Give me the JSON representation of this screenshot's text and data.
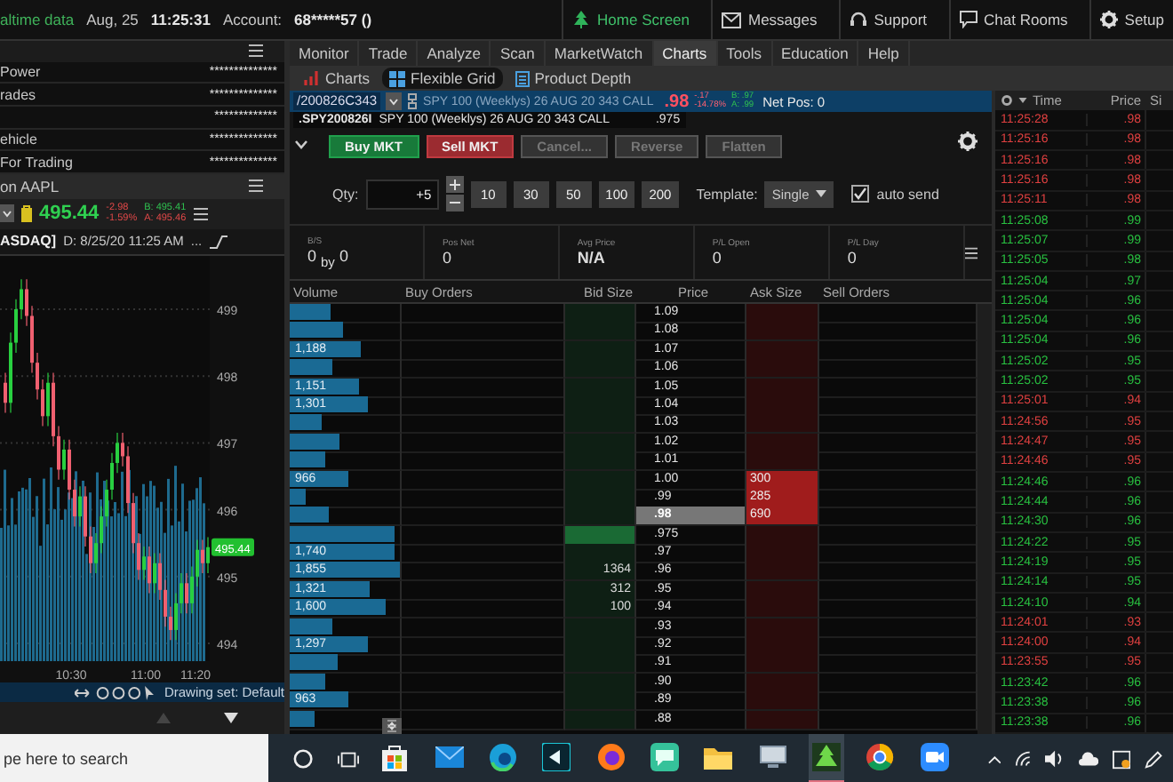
{
  "top_bar": {
    "data_feed": "altime data",
    "date": "Aug, 25",
    "time": "11:25:31",
    "account_label": "Account:",
    "account": "68*****57 ()",
    "links": [
      {
        "kind": "home",
        "label": "Home Screen",
        "selected": true
      },
      {
        "kind": "messages",
        "label": "Messages",
        "selected": false
      },
      {
        "kind": "support",
        "label": "Support",
        "selected": false
      },
      {
        "kind": "chat",
        "label": "Chat Rooms",
        "selected": false
      },
      {
        "kind": "setup",
        "label": "Setup",
        "selected": false
      }
    ]
  },
  "account_panel": {
    "rows": [
      {
        "label": "Power",
        "value": "**************"
      },
      {
        "label": "rades",
        "value": "**************"
      },
      {
        "value": "*************"
      },
      {
        "label": "ehicle",
        "value": "**************"
      },
      {
        "label": "For Trading",
        "value": "**************"
      }
    ]
  },
  "quote_panel": {
    "title": "on AAPL",
    "last": "495.44",
    "change": "-2.98",
    "change_pct": "-1.59%",
    "bid": "B: 495.41",
    "ask": "A: 495.46"
  },
  "chart": {
    "exchange": "ASDAQ]",
    "timestamp": "D: 8/25/20 11:25 AM",
    "more": "...",
    "price_ticks": [
      "499",
      "498",
      "497",
      "496",
      "495",
      "494"
    ],
    "time_ticks": [
      "10:30",
      "11:00",
      "11:20"
    ],
    "last_tag": "495.44",
    "drawing_set": "Drawing set: Default"
  },
  "main_tabs": [
    {
      "label": "Monitor",
      "selected": false
    },
    {
      "label": "Trade",
      "selected": false
    },
    {
      "label": "Analyze",
      "selected": false
    },
    {
      "label": "Scan",
      "selected": false
    },
    {
      "label": "MarketWatch",
      "selected": false
    },
    {
      "label": "Charts",
      "selected": true
    },
    {
      "label": "Tools",
      "selected": false
    },
    {
      "label": "Education",
      "selected": false
    },
    {
      "label": "Help",
      "selected": false
    }
  ],
  "sub_tabs": [
    {
      "kind": "charts",
      "label": "Charts",
      "selected": false
    },
    {
      "kind": "grid",
      "label": "Flexible Grid",
      "selected": true
    },
    {
      "kind": "depth",
      "label": "Product Depth",
      "selected": false
    }
  ],
  "symbol_bar": {
    "symbol": "/200826C343",
    "description": "SPY 100 (Weeklys) 26 AUG 20 343 CALL",
    "last": ".98",
    "change": "-.17",
    "change_pct": "-14.78%",
    "bid": "B: .97",
    "ask": "A: .99",
    "net_pos": "Net Pos: 0",
    "suggestion": {
      "symbol": ".SPY200826I",
      "description": "SPY 100 (Weeklys) 26 AUG 20 343 CALL",
      "price": ".975"
    }
  },
  "order_buttons": [
    {
      "kind": "buy",
      "label": "Buy MKT",
      "disabled": false
    },
    {
      "kind": "sell",
      "label": "Sell MKT",
      "disabled": false
    },
    {
      "kind": "plain",
      "label": "Cancel...",
      "disabled": true
    },
    {
      "kind": "plain",
      "label": "Reverse",
      "disabled": true
    },
    {
      "kind": "plain",
      "label": "Flatten",
      "disabled": true
    }
  ],
  "quantity": {
    "label": "Qty:",
    "value": "+5",
    "presets": [
      "10",
      "30",
      "50",
      "100",
      "200"
    ],
    "template_label": "Template:",
    "template": "Single",
    "auto_send": {
      "label": "auto send",
      "checked": true
    }
  },
  "position": [
    {
      "label": "B/S",
      "value": "0 $_{by}$ 0",
      "bold": false
    },
    {
      "label": "Pos Net",
      "value": "0",
      "bold": false
    },
    {
      "label": "Avg Price",
      "value": "N/A",
      "bold": true
    },
    {
      "label": "P/L Open",
      "value": "0",
      "bold": false
    },
    {
      "label": "P/L Day",
      "value": "0",
      "bold": false
    }
  ],
  "ladder": {
    "columns": [
      "Volume",
      "Buy Orders",
      "Bid Size",
      "Price",
      "Ask Size",
      "Sell Orders"
    ],
    "rows": [
      {
        "level": 0.37,
        "price": "1.09",
        "last": false,
        "bid_fill": false
      },
      {
        "level": 0.49,
        "price": "1.08",
        "last": false,
        "bid_fill": false
      },
      {
        "level": 0.65,
        "volume": "1,188",
        "price": "1.07",
        "last": false,
        "bid_fill": false
      },
      {
        "level": 0.39,
        "price": "1.06",
        "last": false,
        "bid_fill": false
      },
      {
        "level": 0.63,
        "volume": "1,151",
        "price": "1.05",
        "last": false,
        "bid_fill": false
      },
      {
        "level": 0.71,
        "volume": "1,301",
        "price": "1.04",
        "last": false,
        "bid_fill": false
      },
      {
        "level": 0.29,
        "price": "1.03",
        "last": false,
        "bid_fill": false
      },
      {
        "level": 0.45,
        "price": "1.02",
        "last": false,
        "bid_fill": false
      },
      {
        "level": 0.32,
        "price": "1.01",
        "last": false,
        "bid_fill": false
      },
      {
        "level": 0.53,
        "volume": "966",
        "price": "1.00",
        "ask_size": "300",
        "last": false,
        "bid_fill": false
      },
      {
        "level": 0.15,
        "price": ".99",
        "ask_size": "285",
        "last": false,
        "bid_fill": false
      },
      {
        "level": 0.35,
        "price": ".98",
        "ask_size": "690",
        "last": true,
        "bid_fill": false
      },
      {
        "level": 0.95,
        "price": ".975",
        "last": false,
        "bid_fill": true
      },
      {
        "level": 0.95,
        "volume": "1,740",
        "price": ".97",
        "last": false,
        "bid_fill": false
      },
      {
        "level": 1.0,
        "volume": "1,855",
        "price": ".96",
        "bid_size": "1364",
        "last": false,
        "bid_fill": false
      },
      {
        "level": 0.72,
        "volume": "1,321",
        "price": ".95",
        "bid_size": "312",
        "last": false,
        "bid_fill": false
      },
      {
        "level": 0.87,
        "volume": "1,600",
        "price": ".94",
        "bid_size": "100",
        "last": false,
        "bid_fill": false
      },
      {
        "level": 0.39,
        "price": ".93",
        "last": false,
        "bid_fill": false
      },
      {
        "level": 0.71,
        "volume": "1,297",
        "price": ".92",
        "last": false,
        "bid_fill": false
      },
      {
        "level": 0.43,
        "price": ".91",
        "last": false,
        "bid_fill": false
      },
      {
        "level": 0.33,
        "price": ".90",
        "last": false,
        "bid_fill": false
      },
      {
        "level": 0.53,
        "volume": "963",
        "price": ".89",
        "last": false,
        "bid_fill": false
      },
      {
        "level": 0.23,
        "price": ".88",
        "last": false,
        "bid_fill": false
      }
    ]
  },
  "time_sales": {
    "columns": [
      "Time",
      "Price",
      "Si"
    ],
    "rows": [
      {
        "time": "11:25:28",
        "price": ".98",
        "color": "#e04040"
      },
      {
        "time": "11:25:16",
        "price": ".98",
        "color": "#e04040"
      },
      {
        "time": "11:25:16",
        "price": ".98",
        "color": "#e04040"
      },
      {
        "time": "11:25:16",
        "price": ".98",
        "color": "#e04040"
      },
      {
        "time": "11:25:11",
        "price": ".98",
        "color": "#e04040"
      },
      {
        "time": "11:25:08",
        "price": ".99",
        "color": "#28c040"
      },
      {
        "time": "11:25:07",
        "price": ".99",
        "color": "#28c040"
      },
      {
        "time": "11:25:05",
        "price": ".98",
        "color": "#28c040"
      },
      {
        "time": "11:25:04",
        "price": ".97",
        "color": "#28c040"
      },
      {
        "time": "11:25:04",
        "price": ".96",
        "color": "#28c040"
      },
      {
        "time": "11:25:04",
        "price": ".96",
        "color": "#28c040"
      },
      {
        "time": "11:25:04",
        "price": ".96",
        "color": "#28c040"
      },
      {
        "time": "11:25:02",
        "price": ".95",
        "color": "#28c040"
      },
      {
        "time": "11:25:02",
        "price": ".95",
        "color": "#28c040"
      },
      {
        "time": "11:25:01",
        "price": ".94",
        "color": "#e04040"
      },
      {
        "time": "11:24:56",
        "price": ".95",
        "color": "#e04040"
      },
      {
        "time": "11:24:47",
        "price": ".95",
        "color": "#e04040"
      },
      {
        "time": "11:24:46",
        "price": ".95",
        "color": "#e04040"
      },
      {
        "time": "11:24:46",
        "price": ".96",
        "color": "#28c040"
      },
      {
        "time": "11:24:44",
        "price": ".96",
        "color": "#28c040"
      },
      {
        "time": "11:24:30",
        "price": ".96",
        "color": "#28c040"
      },
      {
        "time": "11:24:22",
        "price": ".95",
        "color": "#28c040"
      },
      {
        "time": "11:24:19",
        "price": ".95",
        "color": "#28c040"
      },
      {
        "time": "11:24:14",
        "price": ".95",
        "color": "#28c040"
      },
      {
        "time": "11:24:10",
        "price": ".94",
        "color": "#28c040"
      },
      {
        "time": "11:24:01",
        "price": ".93",
        "color": "#e04040"
      },
      {
        "time": "11:24:00",
        "price": ".94",
        "color": "#e04040"
      },
      {
        "time": "11:23:55",
        "price": ".95",
        "color": "#e04040"
      },
      {
        "time": "11:23:42",
        "price": ".96",
        "color": "#28c040"
      },
      {
        "time": "11:23:38",
        "price": ".96",
        "color": "#28c040"
      },
      {
        "time": "11:23:38",
        "price": ".96",
        "color": "#28c040"
      }
    ]
  },
  "taskbar": {
    "search_placeholder": "pe here to search",
    "apps": [
      {
        "kind": "store",
        "active": false
      },
      {
        "kind": "mail",
        "active": false
      },
      {
        "kind": "edge",
        "active": false
      },
      {
        "kind": "capture",
        "active": false
      },
      {
        "kind": "firefox",
        "active": false
      },
      {
        "kind": "chat",
        "active": false
      },
      {
        "kind": "folder",
        "active": false
      },
      {
        "kind": "pc",
        "active": false
      },
      {
        "kind": "tos",
        "active": true
      },
      {
        "kind": "chrome",
        "active": false
      },
      {
        "kind": "zoom",
        "active": false
      }
    ]
  }
}
